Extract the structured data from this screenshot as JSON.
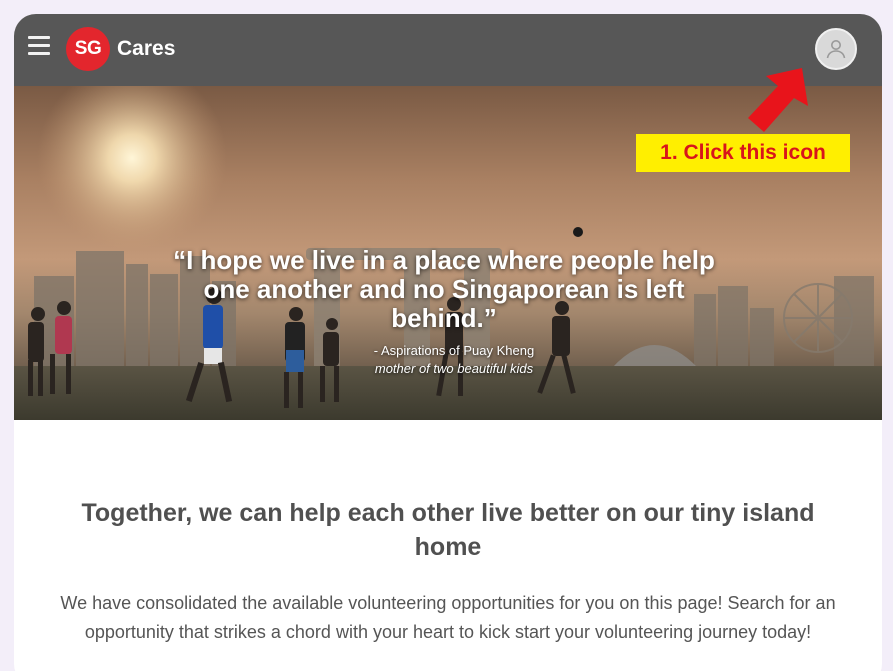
{
  "header": {
    "menu_icon": "hamburger-menu-icon",
    "logo_mark": "SG",
    "logo_text": "Cares",
    "profile_icon": "user-profile-icon"
  },
  "hero": {
    "quote": "“I hope we live in a place where people help one another and no Singaporean is left behind.”",
    "attribution": "- Aspirations of Puay Kheng",
    "attribution_sub": "mother of two beautiful kids"
  },
  "annotation": {
    "callout": "1. Click this icon",
    "callout_bg": "#ffef00",
    "callout_color": "#d8141b",
    "arrow_color": "#e8141b"
  },
  "main": {
    "headline": "Together, we can help each other live better on our tiny island home",
    "body": "We have consolidated the available volunteering opportunities for you on this page! Search for an opportunity that strikes a chord with your heart to kick start your volunteering journey today!"
  },
  "colors": {
    "appbar": "#575757",
    "brand_red": "#e3262d",
    "background": "#f3eef9"
  }
}
